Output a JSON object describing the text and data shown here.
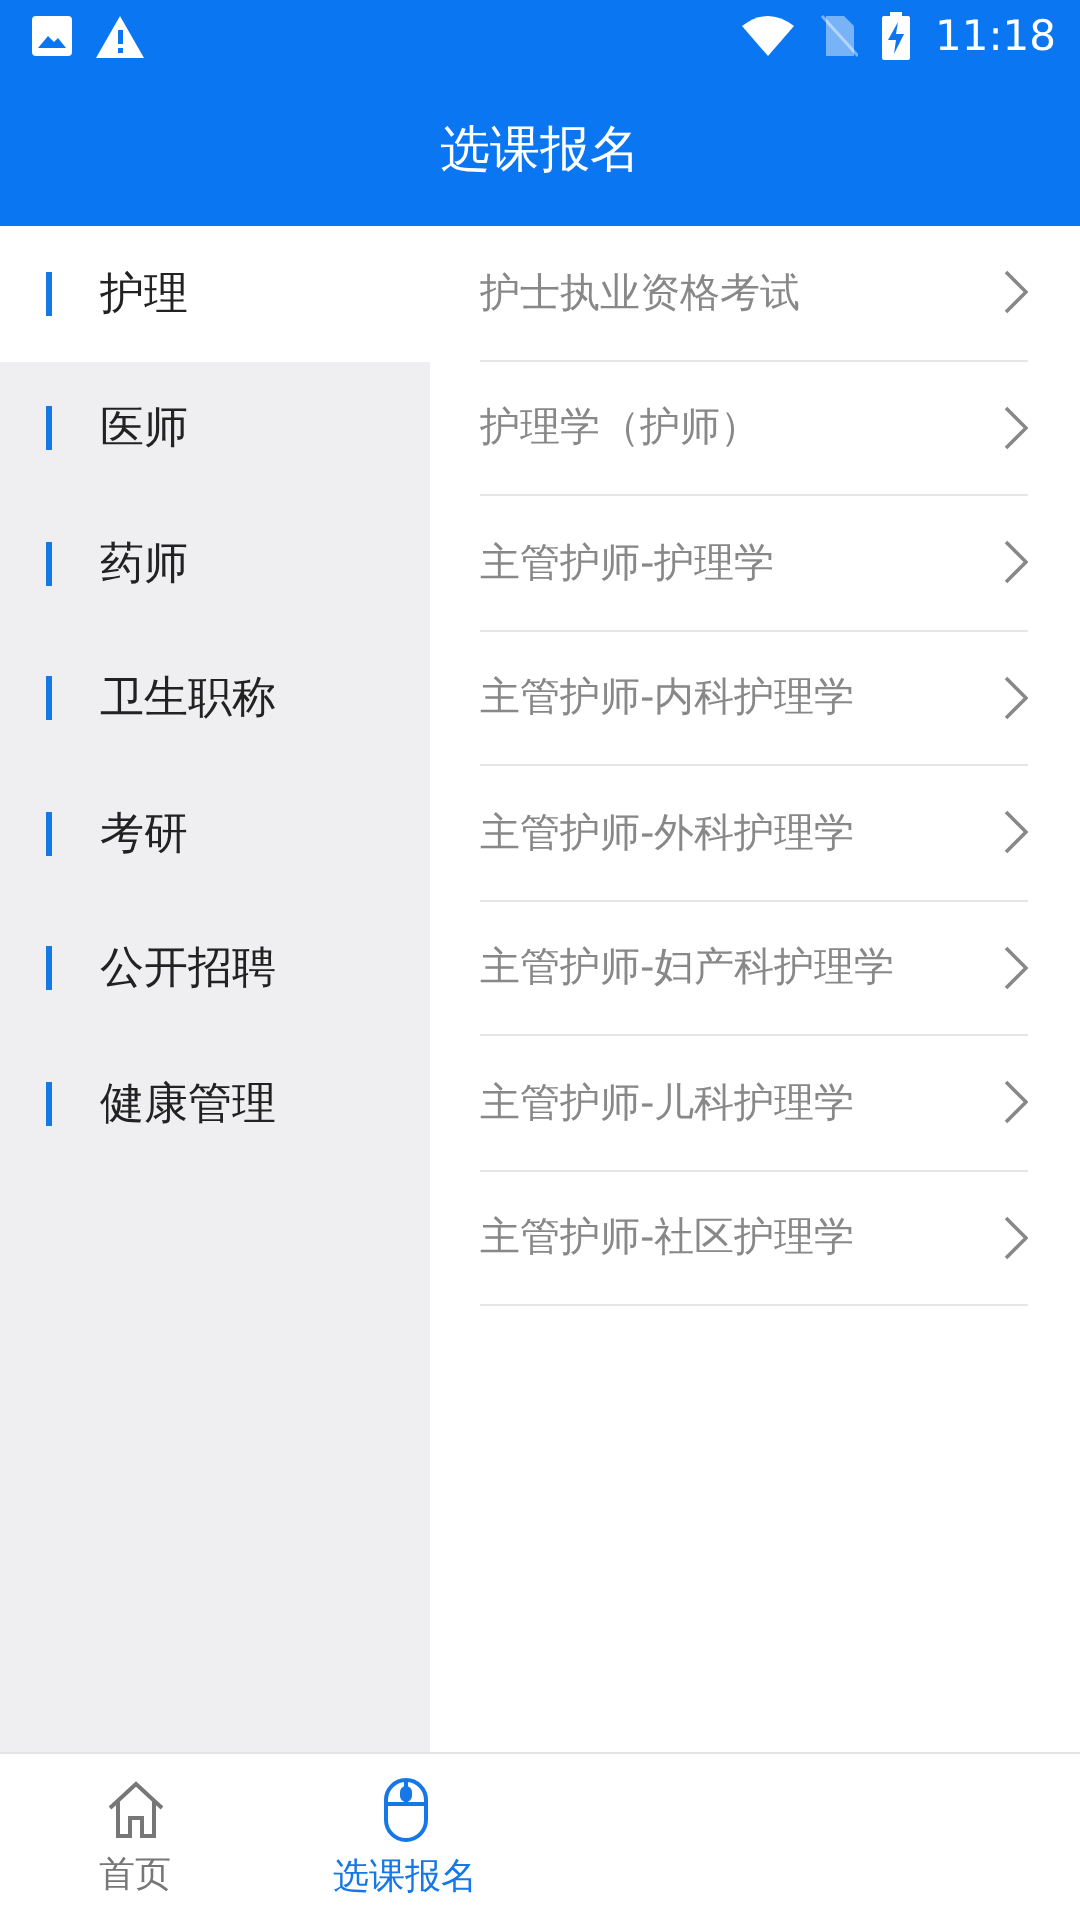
{
  "status_bar": {
    "time": "11:18"
  },
  "header": {
    "title": "选课报名"
  },
  "sidebar": {
    "items": [
      {
        "label": "护理",
        "selected": true
      },
      {
        "label": "医师",
        "selected": false
      },
      {
        "label": "药师",
        "selected": false
      },
      {
        "label": "卫生职称",
        "selected": false
      },
      {
        "label": "考研",
        "selected": false
      },
      {
        "label": "公开招聘",
        "selected": false
      },
      {
        "label": "健康管理",
        "selected": false
      }
    ]
  },
  "courses": [
    "护士执业资格考试",
    "护理学（护师）",
    "主管护师-护理学",
    "主管护师-内科护理学",
    "主管护师-外科护理学",
    "主管护师-妇产科护理学",
    "主管护师-儿科护理学",
    "主管护师-社区护理学"
  ],
  "bottom_nav": [
    {
      "label": "首页",
      "kind": "home",
      "selected": false
    },
    {
      "label": "选课报名",
      "kind": "mouse",
      "selected": true
    }
  ]
}
